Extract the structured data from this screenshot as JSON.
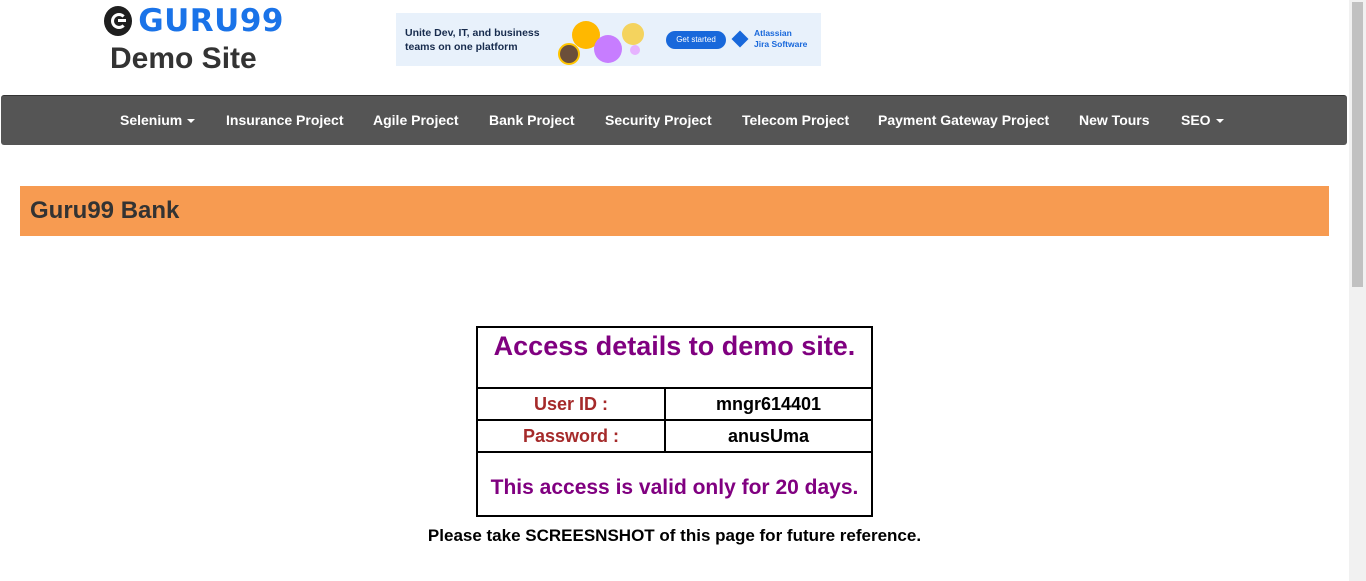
{
  "header": {
    "logo_text": "GURU99",
    "site_title": "Demo Site"
  },
  "ad": {
    "headline": "Unite Dev, IT, and business teams on one platform",
    "button_label": "Get started",
    "brand_line1": "Atlassian",
    "brand_line2": "Jira Software",
    "brand_color": "#1868db"
  },
  "nav": {
    "items": [
      {
        "label": "Selenium",
        "dropdown": true
      },
      {
        "label": "Insurance Project",
        "dropdown": false
      },
      {
        "label": "Agile Project",
        "dropdown": false
      },
      {
        "label": "Bank Project",
        "dropdown": false
      },
      {
        "label": "Security Project",
        "dropdown": false
      },
      {
        "label": "Telecom Project",
        "dropdown": false
      },
      {
        "label": "Payment Gateway Project",
        "dropdown": false
      },
      {
        "label": "New Tours",
        "dropdown": false
      },
      {
        "label": "SEO",
        "dropdown": true
      }
    ],
    "background_color": "#555555"
  },
  "banner": {
    "title": "Guru99 Bank",
    "color": "#f79b51"
  },
  "access": {
    "heading": "Access details to demo site.",
    "user_id_label": "User ID :",
    "user_id_value": "mngr614401",
    "password_label": "Password :",
    "password_value": "anusUma",
    "validity": "This access is valid only for 20 days.",
    "heading_color": "#800080",
    "label_color": "#a52a2a"
  },
  "note": "Please take SCREESNSHOT of this page for future reference."
}
